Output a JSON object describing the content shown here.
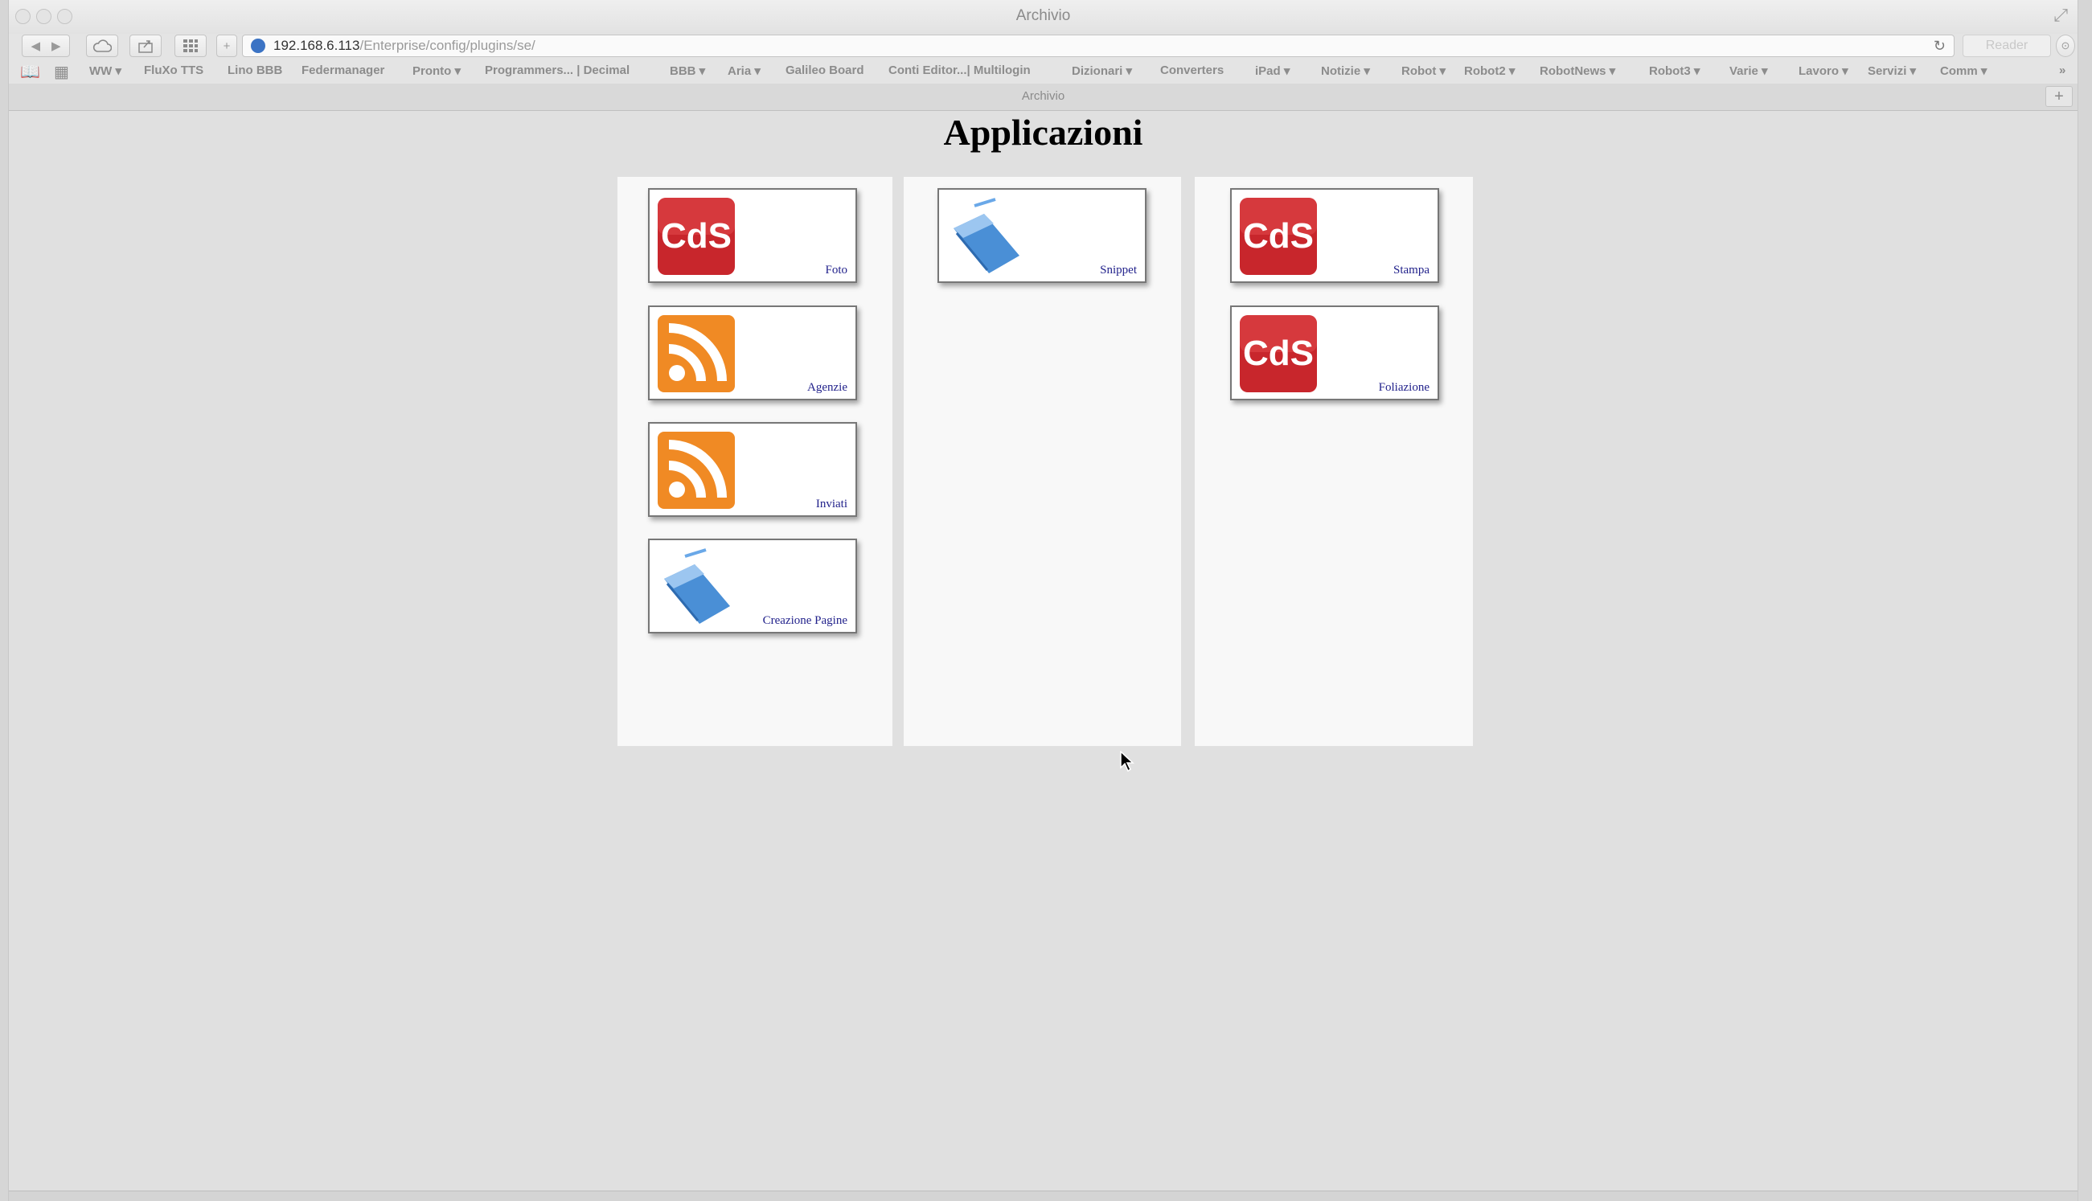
{
  "window": {
    "title": "Archivio"
  },
  "toolbar": {
    "url_host": "192.168.6.113",
    "url_path": "/Enterprise/config/plugins/se/",
    "reader_label": "Reader",
    "new_tab_label": "+"
  },
  "bookmarks": [
    {
      "label": "WW ▾"
    },
    {
      "label": "FluXo TTS"
    },
    {
      "label": "Lino BBB"
    },
    {
      "label": "Federmanager"
    },
    {
      "label": "Pronto ▾"
    },
    {
      "label": "Programmers... | Decimal"
    },
    {
      "label": "BBB ▾"
    },
    {
      "label": "Aria ▾"
    },
    {
      "label": "Galileo Board"
    },
    {
      "label": "Conti Editor...| Multilogin"
    },
    {
      "label": "Dizionari ▾"
    },
    {
      "label": "Converters"
    },
    {
      "label": "iPad ▾"
    },
    {
      "label": "Notizie ▾"
    },
    {
      "label": "Robot ▾"
    },
    {
      "label": "Robot2 ▾"
    },
    {
      "label": "RobotNews ▾"
    },
    {
      "label": "Robot3 ▾"
    },
    {
      "label": "Varie ▾"
    },
    {
      "label": "Lavoro ▾"
    },
    {
      "label": "Servizi ▾"
    },
    {
      "label": "Comm ▾"
    }
  ],
  "tab": {
    "label": "Archivio"
  },
  "page": {
    "title": "Applicazioni",
    "columns": [
      {
        "apps": [
          {
            "label": "Foto",
            "icon": "cds-icon"
          },
          {
            "label": "Agenzie",
            "icon": "rss-icon"
          },
          {
            "label": "Inviati",
            "icon": "rss-icon"
          },
          {
            "label": "Creazione Pagine",
            "icon": "book-icon"
          }
        ]
      },
      {
        "apps": [
          {
            "label": "Snippet",
            "icon": "book-icon"
          }
        ]
      },
      {
        "apps": [
          {
            "label": "Stampa",
            "icon": "cds-icon"
          },
          {
            "label": "Foliazione",
            "icon": "cds-icon"
          }
        ]
      }
    ]
  },
  "colors": {
    "cds_red": "#c8262c",
    "rss_orange": "#f08a24",
    "book_blue": "#4a8fd6",
    "label_blue": "#1f1f8a"
  }
}
